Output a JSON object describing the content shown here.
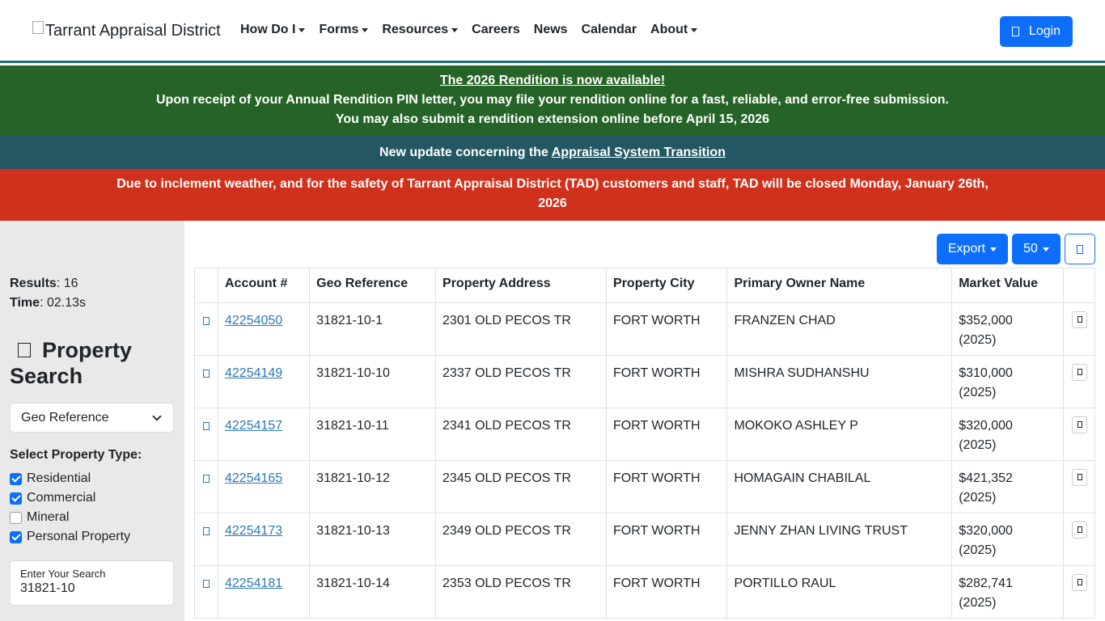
{
  "header": {
    "brand": "Tarrant Appraisal District",
    "nav": [
      {
        "label": "How Do I",
        "dropdown": true
      },
      {
        "label": "Forms",
        "dropdown": true
      },
      {
        "label": "Resources",
        "dropdown": true
      },
      {
        "label": "Careers",
        "dropdown": false
      },
      {
        "label": "News",
        "dropdown": false
      },
      {
        "label": "Calendar",
        "dropdown": false
      },
      {
        "label": "About",
        "dropdown": true
      }
    ],
    "login_label": "Login"
  },
  "alerts": {
    "green": {
      "title": "The 2026 Rendition is now available!",
      "line1": "Upon receipt of your Annual Rendition PIN letter, you may file your rendition online for a fast, reliable, and error-free submission.",
      "line2": "You may also submit a rendition extension online before April 15, 2026"
    },
    "teal": {
      "text": "New update concerning the ",
      "link": "Appraisal System Transition"
    },
    "red": {
      "text": "Due to inclement weather, and for the safety of Tarrant Appraisal District (TAD) customers and staff, TAD will be closed Monday, January 26th, 2026"
    }
  },
  "sidebar": {
    "results_label": "Results",
    "results_value": ": 16",
    "time_label": "Time",
    "time_value": ": 02.13s",
    "title": "Property Search",
    "search_type": "Geo Reference",
    "property_type_label": "Select Property Type:",
    "property_types": [
      {
        "label": "Residential",
        "checked": true
      },
      {
        "label": "Commercial",
        "checked": true
      },
      {
        "label": "Mineral",
        "checked": false
      },
      {
        "label": "Personal Property",
        "checked": true
      }
    ],
    "search_label": "Enter Your Search",
    "search_value": "31821-10"
  },
  "toolbar": {
    "export_label": "Export",
    "page_size": "50"
  },
  "table": {
    "headers": [
      "Account #",
      "Geo Reference",
      "Property Address",
      "Property City",
      "Primary Owner Name",
      "Market Value"
    ],
    "rows": [
      {
        "account": "42254050",
        "geo": "31821-10-1",
        "address": "2301 OLD PECOS TR",
        "city": "FORT WORTH",
        "owner": "FRANZEN CHAD",
        "value": "$352,000",
        "year": "(2025)"
      },
      {
        "account": "42254149",
        "geo": "31821-10-10",
        "address": "2337 OLD PECOS TR",
        "city": "FORT WORTH",
        "owner": "MISHRA SUDHANSHU",
        "value": "$310,000",
        "year": "(2025)"
      },
      {
        "account": "42254157",
        "geo": "31821-10-11",
        "address": "2341 OLD PECOS TR",
        "city": "FORT WORTH",
        "owner": "MOKOKO ASHLEY P",
        "value": "$320,000",
        "year": "(2025)"
      },
      {
        "account": "42254165",
        "geo": "31821-10-12",
        "address": "2345 OLD PECOS TR",
        "city": "FORT WORTH",
        "owner": "HOMAGAIN CHABILAL",
        "value": "$421,352",
        "year": "(2025)"
      },
      {
        "account": "42254173",
        "geo": "31821-10-13",
        "address": "2349 OLD PECOS TR",
        "city": "FORT WORTH",
        "owner": "JENNY ZHAN LIVING TRUST",
        "value": "$320,000",
        "year": "(2025)"
      },
      {
        "account": "42254181",
        "geo": "31821-10-14",
        "address": "2353 OLD PECOS TR",
        "city": "FORT WORTH",
        "owner": "PORTILLO RAUL",
        "value": "$282,741",
        "year": "(2025)"
      }
    ]
  }
}
